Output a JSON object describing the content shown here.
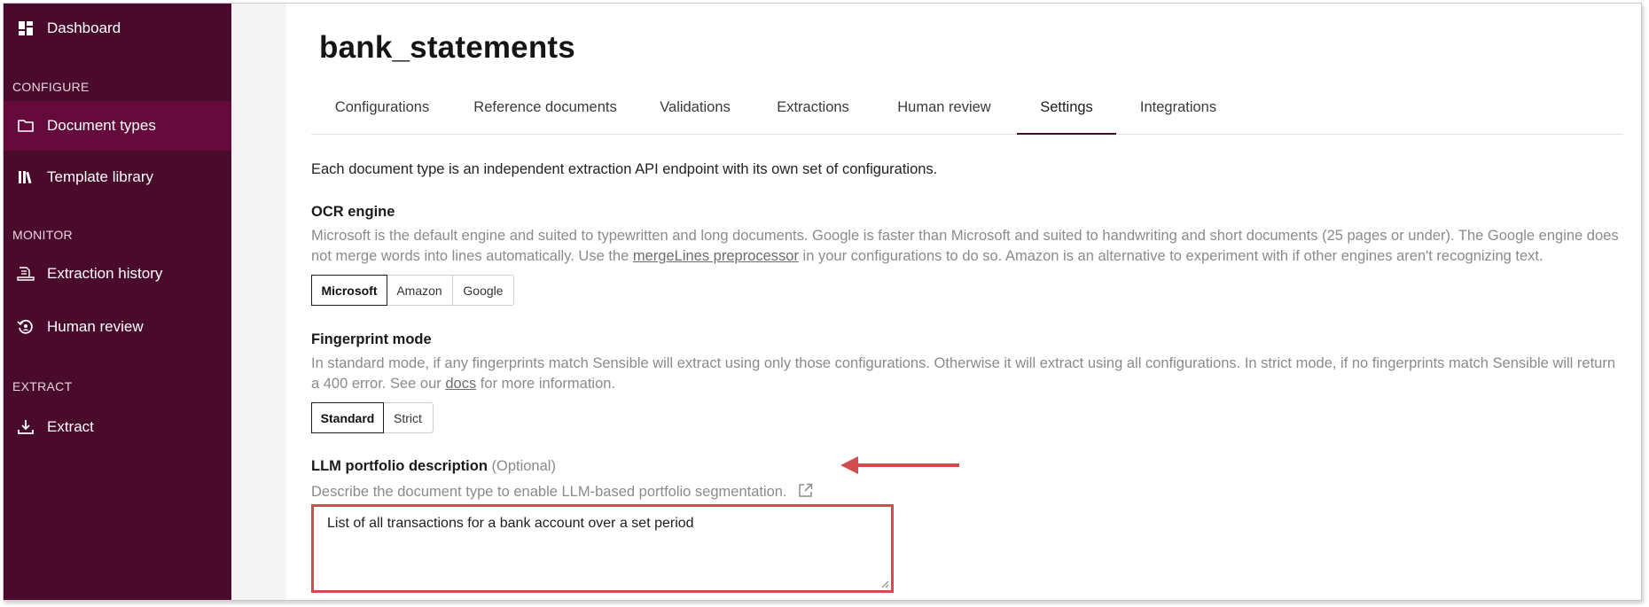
{
  "sidebar": {
    "items": [
      {
        "label": "Dashboard",
        "icon": "dashboard-icon"
      },
      {
        "label": "Document types",
        "icon": "folder-icon",
        "active": true
      },
      {
        "label": "Template library",
        "icon": "library-icon"
      },
      {
        "label": "Extraction history",
        "icon": "history-icon"
      },
      {
        "label": "Human review",
        "icon": "review-icon"
      },
      {
        "label": "Extract",
        "icon": "download-icon"
      }
    ],
    "sections": {
      "configure": "CONFIGURE",
      "monitor": "MONITOR",
      "extract": "EXTRACT"
    },
    "bg_color": "#4a0a2c",
    "active_color": "#650b3c"
  },
  "page": {
    "title": "bank_statements"
  },
  "tabs": [
    {
      "label": "Configurations"
    },
    {
      "label": "Reference documents"
    },
    {
      "label": "Validations"
    },
    {
      "label": "Extractions"
    },
    {
      "label": "Human review"
    },
    {
      "label": "Settings",
      "active": true
    },
    {
      "label": "Integrations"
    }
  ],
  "intro": "Each document type is an independent extraction API endpoint with its own set of configurations.",
  "ocr": {
    "title": "OCR engine",
    "desc_part1": "Microsoft is the default engine and suited to typewritten and long documents. Google is faster than Microsoft and suited to handwriting and short documents (25 pages or under). The Google engine does not merge words into lines automatically. Use the ",
    "desc_link": "mergeLines preprocessor",
    "desc_part2": " in your configurations to do so. Amazon is an alternative to experiment with if other engines aren't recognizing text.",
    "options": [
      "Microsoft",
      "Amazon",
      "Google"
    ],
    "selected": "Microsoft"
  },
  "fingerprint": {
    "title": "Fingerprint mode",
    "desc_part1": "In standard mode, if any fingerprints match Sensible will extract using only those configurations. Otherwise it will extract using all configurations. In strict mode, if no fingerprints match Sensible will return a 400 error. See our ",
    "desc_link": "docs",
    "desc_part2": " for more information.",
    "options": [
      "Standard",
      "Strict"
    ],
    "selected": "Standard"
  },
  "llm": {
    "title": "LLM portfolio description",
    "optional": "(Optional)",
    "desc": "Describe the document type to enable LLM-based portfolio segmentation.",
    "value": "List of all transactions for a bank account over a set period"
  },
  "annotation_color": "#d14c4c"
}
